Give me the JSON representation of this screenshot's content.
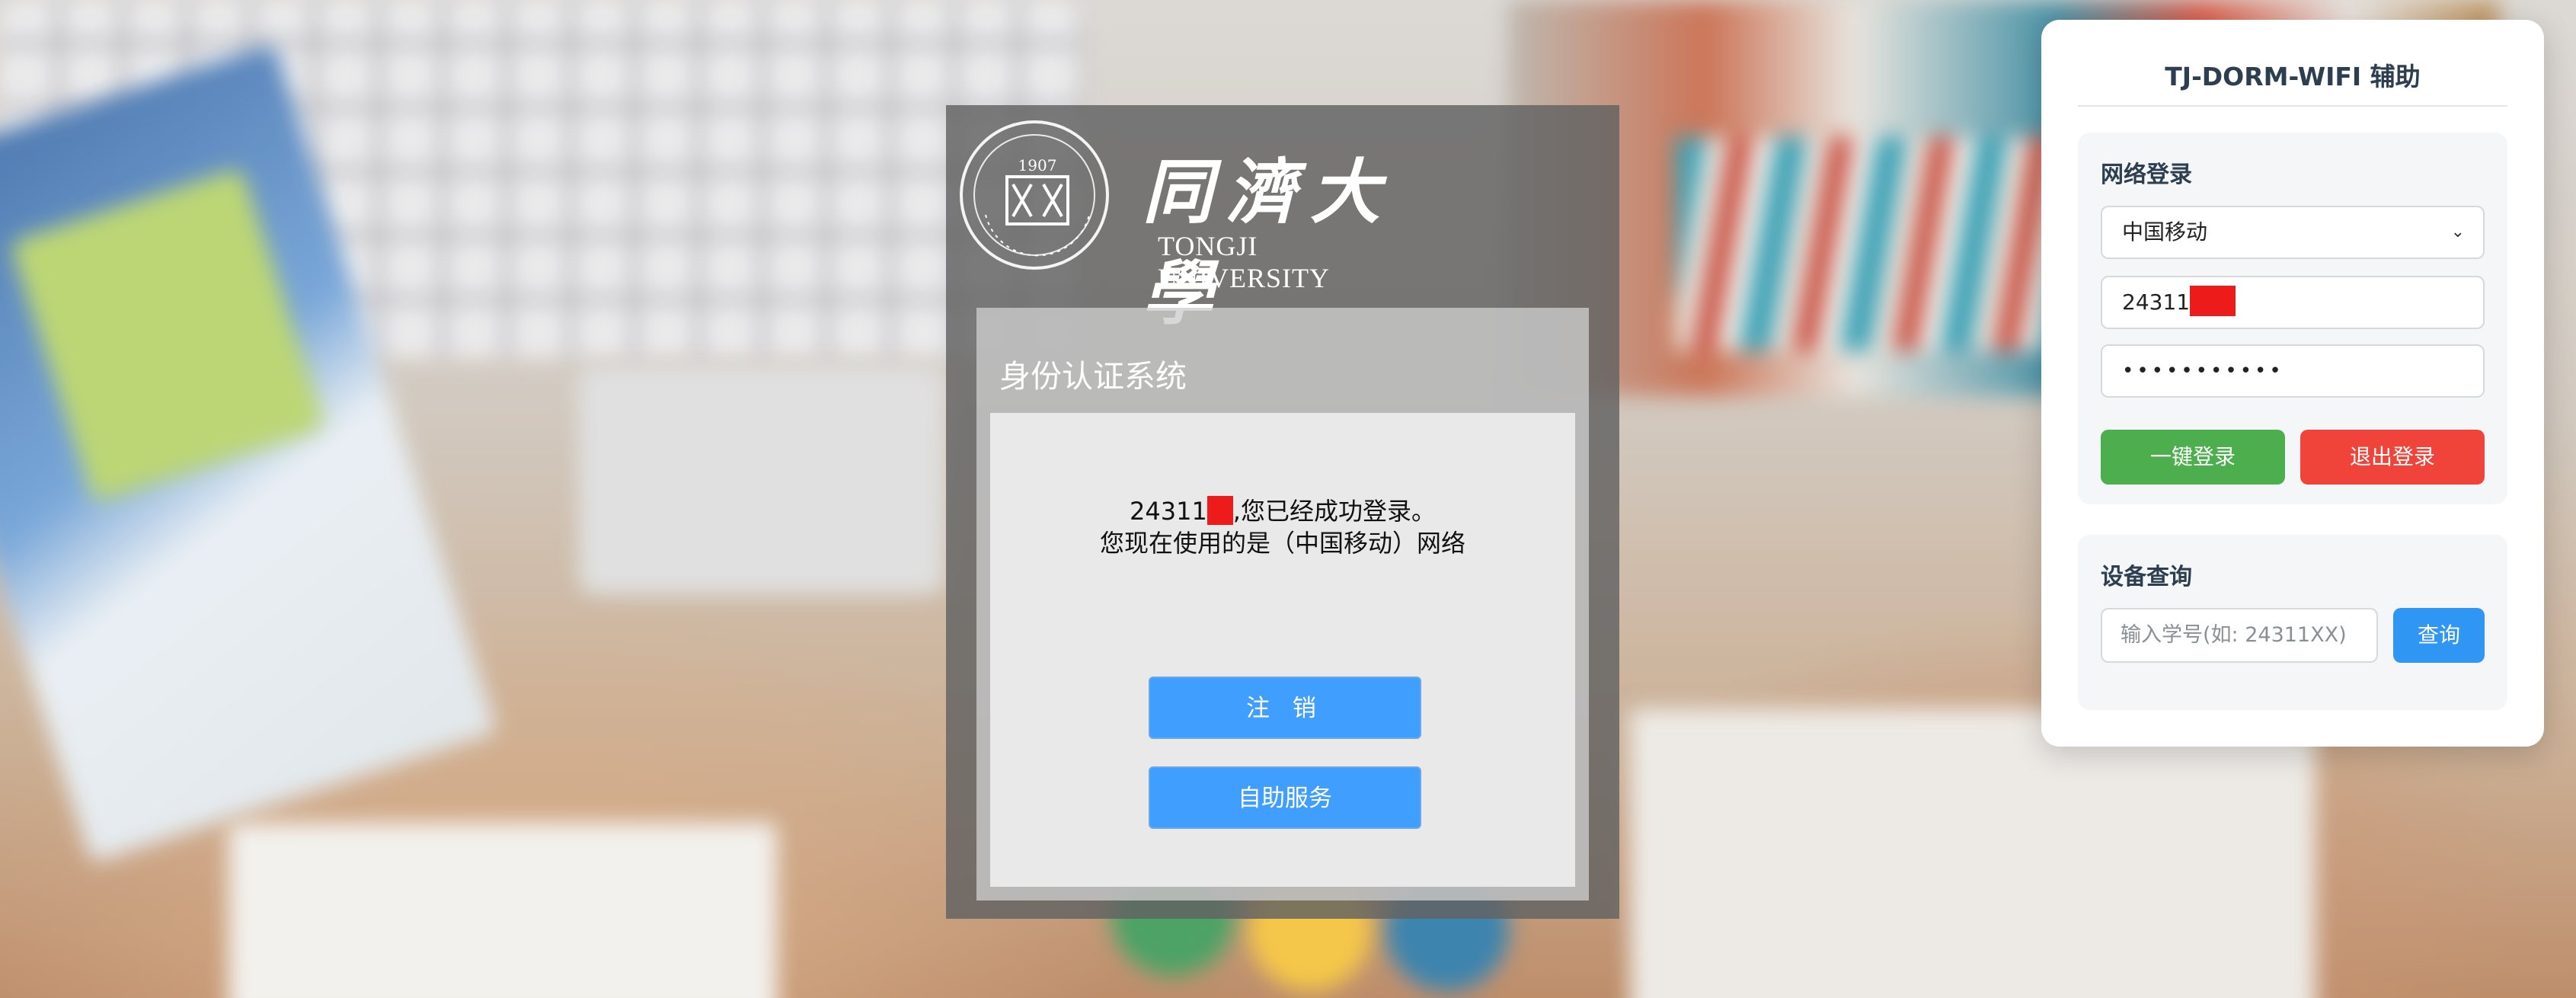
{
  "portal": {
    "logo_cn": "同濟大學",
    "logo_en": "TONGJI UNIVERSITY",
    "system_title": "身份认证系统",
    "user_prefix": "24311",
    "login_success": ",您已经成功登录。",
    "network_msg": "您现在使用的是（中国移动）网络",
    "logout_label": "注 销",
    "self_service_label": "自助服务"
  },
  "helper": {
    "title": "TJ-DORM-WIFI 辅助",
    "login_section": {
      "label": "网络登录",
      "carrier_selected": "中国移动",
      "username_value": "24311",
      "password_value": "•••••••••••",
      "login_button": "一键登录",
      "logout_button": "退出登录"
    },
    "device_section": {
      "label": "设备查询",
      "input_placeholder": "输入学号(如: 24311XX)",
      "query_button": "查询"
    }
  },
  "colors": {
    "primary_blue": "#409eff",
    "green": "#4cae4c",
    "red": "#f0433a",
    "redaction": "#ee1b1b"
  }
}
